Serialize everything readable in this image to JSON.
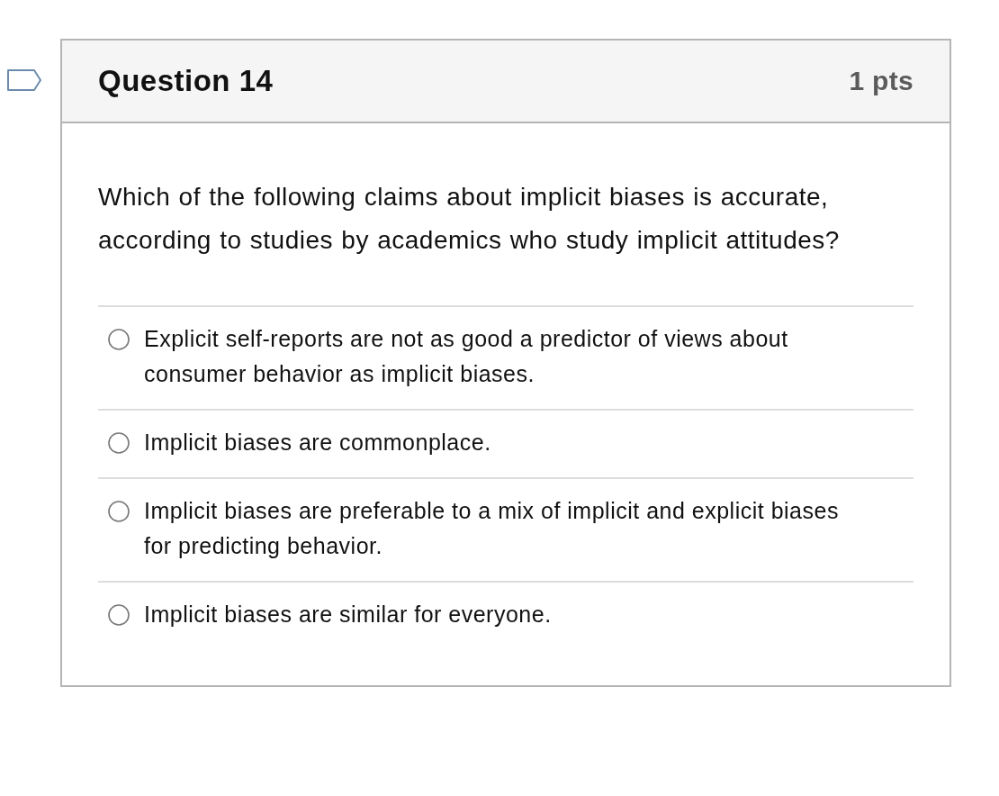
{
  "question": {
    "flag": {
      "flagged": false
    },
    "title": "Question 14",
    "points": "1 pts",
    "text": "Which of the following claims about implicit biases is accurate, according to studies by academics who study implicit attitudes?",
    "answers": [
      {
        "label": "Explicit self-reports are not as good a predictor of views about consumer behavior as implicit biases.",
        "selected": false
      },
      {
        "label": "Implicit biases are commonplace.",
        "selected": false
      },
      {
        "label": "Implicit biases are preferable to a mix of implicit and explicit biases for predicting behavior.",
        "selected": false
      },
      {
        "label": "Implicit biases are similar for everyone.",
        "selected": false
      }
    ]
  }
}
